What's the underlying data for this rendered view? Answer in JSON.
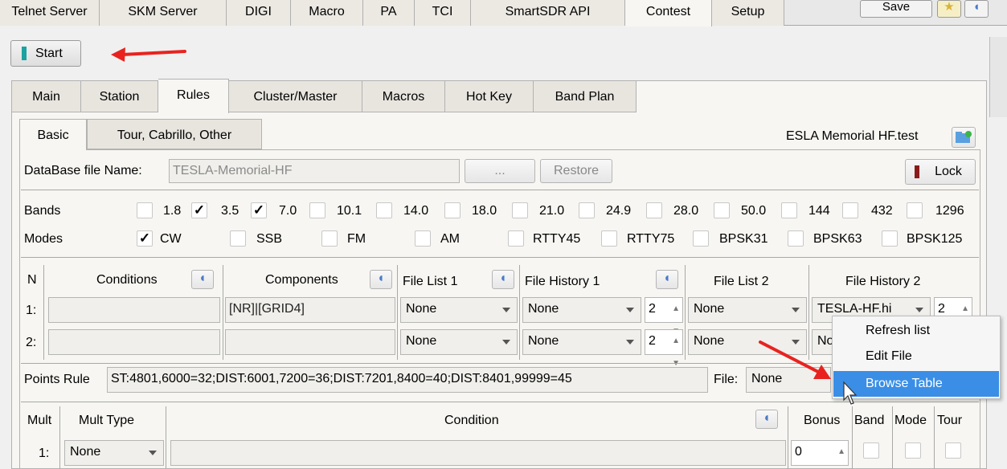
{
  "top_tabs": [
    "Telnet Server",
    "SKM Server",
    "DIGI",
    "Macro",
    "PA",
    "TCI",
    "SmartSDR API",
    "Contest",
    "Setup"
  ],
  "top_buttons": {
    "save": "Save"
  },
  "start_label": "Start",
  "sub_tabs": [
    "Main",
    "Station",
    "Rules",
    "Cluster/Master",
    "Macros",
    "Hot Key",
    "Band Plan"
  ],
  "basic_tabs": [
    "Basic",
    "Tour, Cabrillo, Other"
  ],
  "contest_file": "ESLA Memorial HF.test",
  "database": {
    "label": "DataBase file Name:",
    "value": "TESLA-Memorial-HF",
    "browse": "...",
    "restore": "Restore",
    "lock": "Lock"
  },
  "bands": {
    "label": "Bands",
    "items": [
      {
        "label": "1.8",
        "checked": false
      },
      {
        "label": "3.5",
        "checked": true
      },
      {
        "label": "7.0",
        "checked": true
      },
      {
        "label": "10.1",
        "checked": false
      },
      {
        "label": "14.0",
        "checked": false
      },
      {
        "label": "18.0",
        "checked": false
      },
      {
        "label": "21.0",
        "checked": false
      },
      {
        "label": "24.9",
        "checked": false
      },
      {
        "label": "28.0",
        "checked": false
      },
      {
        "label": "50.0",
        "checked": false
      },
      {
        "label": "144",
        "checked": false
      },
      {
        "label": "432",
        "checked": false
      },
      {
        "label": "1296",
        "checked": false
      }
    ]
  },
  "modes": {
    "label": "Modes",
    "items": [
      {
        "label": "CW",
        "checked": true
      },
      {
        "label": "SSB",
        "checked": false
      },
      {
        "label": "FM",
        "checked": false
      },
      {
        "label": "AM",
        "checked": false
      },
      {
        "label": "RTTY45",
        "checked": false
      },
      {
        "label": "RTTY75",
        "checked": false
      },
      {
        "label": "BPSK31",
        "checked": false
      },
      {
        "label": "BPSK63",
        "checked": false
      },
      {
        "label": "BPSK125",
        "checked": false
      }
    ]
  },
  "grid": {
    "headers": {
      "n": "N",
      "conditions": "Conditions",
      "components": "Components",
      "file_list_1": "File List 1",
      "file_history_1": "File History 1",
      "file_list_2": "File List 2",
      "file_history_2": "File History 2"
    },
    "rows": [
      {
        "n": "1:",
        "conditions": "",
        "components": "[NR]|[GRID4]",
        "file_list_1": "None",
        "file_history_1": "None",
        "spin": "2",
        "file_list_2": "None",
        "file_history_2": "TESLA-HF.hi",
        "spin2": "2"
      },
      {
        "n": "2:",
        "conditions": "",
        "components": "",
        "file_list_1": "None",
        "file_history_1": "None",
        "spin": "2",
        "file_list_2": "None",
        "file_history_2": "No"
      }
    ]
  },
  "points_rule": {
    "label": "Points Rule",
    "value": "ST:4801,6000=32;DIST:6001,7200=36;DIST:7201,8400=40;DIST:8401,99999=45",
    "file_label": "File:",
    "file_value": "None"
  },
  "context_menu": [
    "Refresh list",
    "Edit File",
    "Browse Table"
  ],
  "mult": {
    "headers": {
      "mult": "Mult",
      "mult_type": "Mult Type",
      "condition": "Condition",
      "bonus": "Bonus",
      "band": "Band",
      "mode": "Mode",
      "tour": "Tour"
    },
    "rows": [
      {
        "n": "1:",
        "type": "None",
        "condition": "",
        "bonus": "0"
      }
    ]
  },
  "colors": {
    "accent": "#1aa3a0",
    "lock_bar": "#8b1a1a",
    "arrow": "#e8231f",
    "menu_highlight": "#3a8ee6"
  }
}
